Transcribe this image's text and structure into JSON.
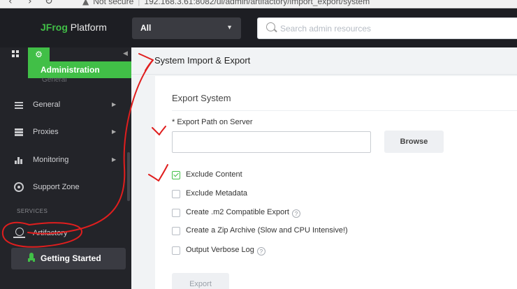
{
  "browser": {
    "security_label": "Not secure",
    "url": "192.168.3.61:8082/ui/admin/artifactory/import_export/system"
  },
  "header": {
    "logo_brand": "JFrog",
    "logo_product": " Platform",
    "scope_select": "All",
    "search_placeholder": "Search admin resources"
  },
  "sidebar": {
    "active_module": "Administration",
    "partial_item": "General",
    "items": [
      {
        "label": "General",
        "icon": "sliders-icon"
      },
      {
        "label": "Proxies",
        "icon": "list-icon"
      },
      {
        "label": "Monitoring",
        "icon": "bar-chart-icon"
      },
      {
        "label": "Support Zone",
        "icon": "support-icon"
      }
    ],
    "services_heading": "SERVICES",
    "service_item": "Artifactory",
    "getting_started": "Getting Started"
  },
  "main": {
    "page_title": "System Import & Export",
    "section_title": "Export System",
    "path_label": "* Export Path on Server",
    "path_value": "",
    "browse_label": "Browse",
    "options": [
      {
        "label": "Exclude Content",
        "checked": true,
        "help": false
      },
      {
        "label": "Exclude Metadata",
        "checked": false,
        "help": false
      },
      {
        "label": "Create .m2 Compatible Export",
        "checked": false,
        "help": true
      },
      {
        "label": "Create a Zip Archive (Slow and CPU Intensive!)",
        "checked": false,
        "help": false
      },
      {
        "label": "Output Verbose Log",
        "checked": false,
        "help": true
      }
    ],
    "export_label": "Export"
  },
  "colors": {
    "accent_green": "#41bf47",
    "sidebar_bg": "#232429",
    "header_bg": "#1d1e23",
    "annotation_red": "#e01e1e"
  }
}
